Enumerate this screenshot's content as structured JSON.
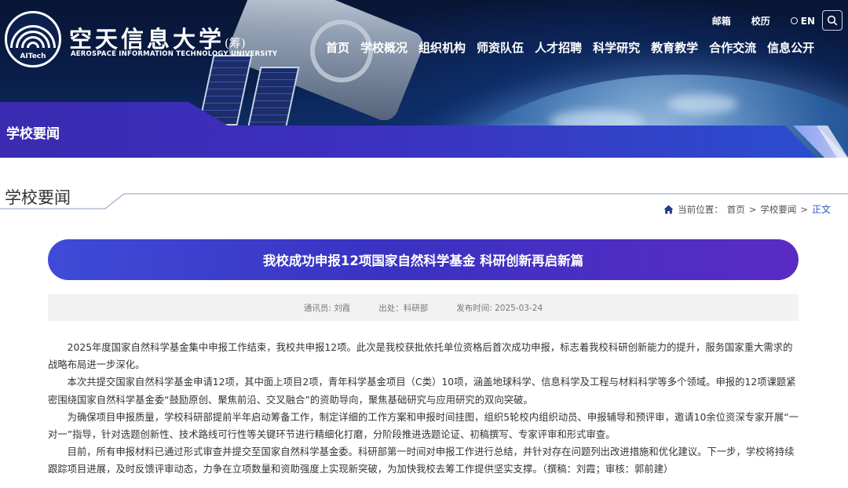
{
  "header": {
    "logo_cn": "空天信息大学",
    "logo_cn_suffix": "(筹)",
    "logo_en": "AEROSPACE INFORMATION TECHNOLOGY UNIVERSITY",
    "logo_tag": "AITech",
    "top_links": [
      "邮箱",
      "校历",
      "EN"
    ],
    "nav": [
      "首页",
      "学校概况",
      "组织机构",
      "师资队伍",
      "人才招聘",
      "科学研究",
      "教育教学",
      "合作交流",
      "信息公开"
    ],
    "section_label": "学校要闻"
  },
  "page": {
    "title": "学校要闻",
    "breadcrumb": {
      "prefix": "当前位置：",
      "items": [
        "首页",
        "学校要闻"
      ],
      "separator": ">",
      "current": "正文"
    }
  },
  "article": {
    "title": "我校成功申报12项国家自然科学基金 科研创新再启新篇",
    "meta": {
      "reporter": "通讯员: 刘霞",
      "source": "出处：科研部",
      "published": "发布时间: 2025-03-24"
    },
    "paragraphs": [
      "2025年度国家自然科学基金集中申报工作结束，我校共申报12项。此次是我校获批依托单位资格后首次成功申报，标志着我校科研创新能力的提升，服务国家重大需求的战略布局进一步深化。",
      "本次共提交国家自然科学基金申请12项，其中面上项目2项，青年科学基金项目（C类）10项，涵盖地球科学、信息科学及工程与材料科学等多个领域。申报的12项课题紧密围绕国家自然科学基金委“鼓励原创、聚焦前沿、交叉融合”的资助导向，聚焦基础研究与应用研究的双向突破。",
      "为确保项目申报质量，学校科研部提前半年启动筹备工作，制定详细的工作方案和申报时间挂图，组织5轮校内组织动员、申报辅导和预评审，邀请10余位资深专家开展“一对一”指导，针对选题创新性、技术路线可行性等关键环节进行精细化打磨，分阶段推进选题论证、初稿撰写、专家评审和形式审查。",
      "目前，所有申报材料已通过形式审查并提交至国家自然科学基金委。科研部第一时间对申报工作进行总结，并针对存在问题列出改进措施和优化建议。下一步，学校将持续跟踪项目进展，及时反馈评审动态，力争在立项数量和资助强度上实现新突破，为加快我校去筹工作提供坚实支撑。（撰稿：刘霞；审核：郭前建）"
    ]
  },
  "colors": {
    "banner_dark": "#0a1f4c",
    "accent_blue": "#3a32c2",
    "link_blue": "#2a56c6"
  }
}
